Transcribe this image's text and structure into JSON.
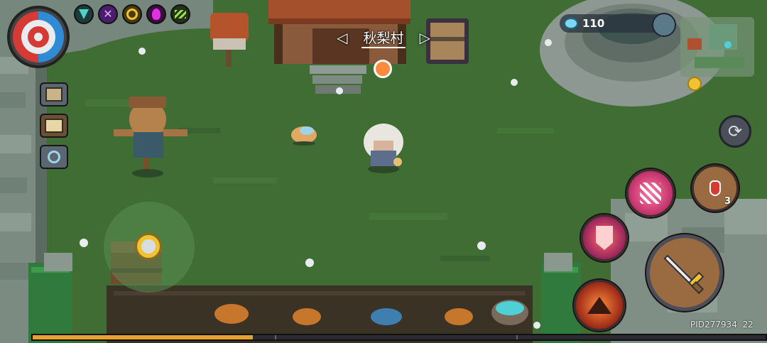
{
  "location": {
    "name": "秋梨村",
    "prev_arrow": "◁",
    "next_arrow": "▷"
  },
  "hud": {
    "gems": {
      "icon": "gem-icon",
      "value": "110"
    },
    "pid_text": "PID277934",
    "pid_number": "22",
    "potion_count": "3"
  },
  "buffs": [
    "rune-buff-icon",
    "cross-buff-icon",
    "target-buff-icon",
    "flame-buff-icon",
    "claw-buff-icon"
  ],
  "side_menu": [
    "journal-icon",
    "map-board-icon",
    "search-magnifier-icon"
  ],
  "skills": [
    "crit-skill-icon",
    "shield-skill-icon",
    "volcano-skill-icon",
    "attack-sword-icon",
    "potion-icon",
    "swap-icon"
  ],
  "progress": {
    "fill_fraction": 0.3
  },
  "colors": {
    "accent": "#ff8a3d",
    "hp_red": "#d63a34",
    "mana_blue": "#2f8bd6",
    "grass": "#3d6b33",
    "hud_dark": "#2b2a33"
  }
}
